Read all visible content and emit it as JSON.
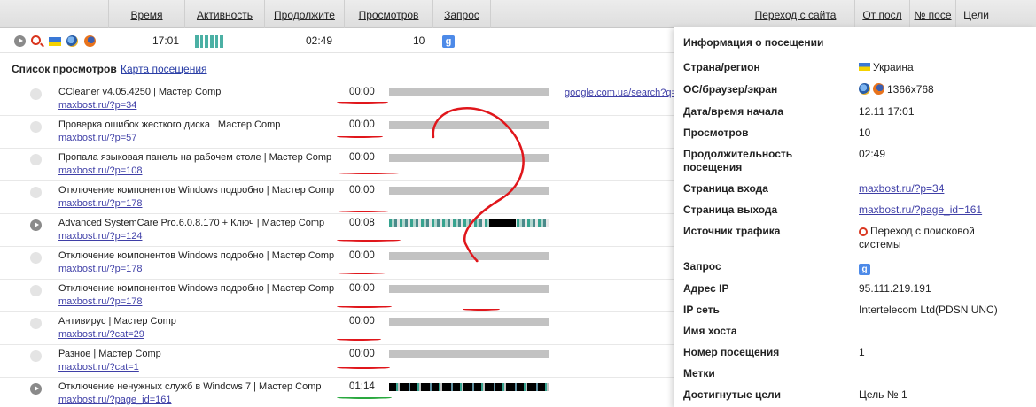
{
  "header": {
    "columns": [
      {
        "key": "time",
        "label": "Время"
      },
      {
        "key": "activity",
        "label": "Активность"
      },
      {
        "key": "duration",
        "label": "Продолжите"
      },
      {
        "key": "views",
        "label": "Просмотров"
      },
      {
        "key": "query",
        "label": "Запрос"
      },
      {
        "key": "referrer",
        "label": "Переход с сайта"
      },
      {
        "key": "from",
        "label": "От посл"
      },
      {
        "key": "visitnum",
        "label": "№ посе"
      },
      {
        "key": "goals",
        "label": "Цели"
      }
    ]
  },
  "summary": {
    "time": "17:01",
    "duration": "02:49",
    "views": "10",
    "query_icon": "g"
  },
  "list": {
    "title": "Список просмотров",
    "map_tab": "Карта посещения"
  },
  "rows": [
    {
      "title": "CCleaner v4.05.4250 | Мастер Comp",
      "url": "maxbost.ru/?p=34",
      "time": "00:00"
    },
    {
      "title": "Проверка ошибок жесткого диска | Мастер Comp",
      "url": "maxbost.ru/?p=57",
      "time": "00:00"
    },
    {
      "title": "Пропала языковая панель на рабочем столе | Мастер Comp",
      "url": "maxbost.ru/?p=108",
      "time": "00:00"
    },
    {
      "title": "Отключение компонентов Windows подробно | Мастер Comp",
      "url": "maxbost.ru/?p=178",
      "time": "00:00"
    },
    {
      "title": "Advanced SystemCare Pro.6.0.8.170 + Ключ | Мастер Comp",
      "url": "maxbost.ru/?p=124",
      "time": "00:08"
    },
    {
      "title": "Отключение компонентов Windows подробно | Мастер Comp",
      "url": "maxbost.ru/?p=178",
      "time": "00:00"
    },
    {
      "title": "Отключение компонентов Windows подробно | Мастер Comp",
      "url": "maxbost.ru/?p=178",
      "time": "00:00"
    },
    {
      "title": "Антивирус | Мастер Comp",
      "url": "maxbost.ru/?cat=29",
      "time": "00:00"
    },
    {
      "title": "Разное | Мастер Comp",
      "url": "maxbost.ru/?cat=1",
      "time": "00:00"
    },
    {
      "title": "Отключение ненужных служб в Windows 7 | Мастер Comp",
      "url": "maxbost.ru/?page_id=161",
      "time": "01:14"
    }
  ],
  "referrer_link": "google.com.ua/search?q=",
  "panel": {
    "title": "Информация о посещении",
    "fields": [
      {
        "label": "Страна/регион",
        "value": "Украина"
      },
      {
        "label": "ОС/браузер/экран",
        "value": "1366x768"
      },
      {
        "label": "Дата/время начала",
        "value": "12.11 17:01"
      },
      {
        "label": "Просмотров",
        "value": "10"
      },
      {
        "label": "Продолжительность посещения",
        "value": "02:49"
      },
      {
        "label": "Страница входа",
        "value": "maxbost.ru/?p=34"
      },
      {
        "label": "Страница выхода",
        "value": "maxbost.ru/?page_id=161"
      },
      {
        "label": "Источник трафика",
        "value": "Переход с поисковой системы"
      },
      {
        "label": "Запрос",
        "value": "g"
      },
      {
        "label": "Адрес IP",
        "value": "95.111.219.191"
      },
      {
        "label": "IP сеть",
        "value": "Intertelecom Ltd(PDSN UNC)"
      },
      {
        "label": "Имя хоста",
        "value": ""
      },
      {
        "label": "Номер посещения",
        "value": "1"
      },
      {
        "label": "Метки",
        "value": ""
      },
      {
        "label": "Достигнутые цели",
        "value": "Цель № 1"
      }
    ]
  },
  "colors": {
    "accent": "#4bb0a4",
    "link": "#3f3fa7",
    "annotation": "#e0161b"
  }
}
